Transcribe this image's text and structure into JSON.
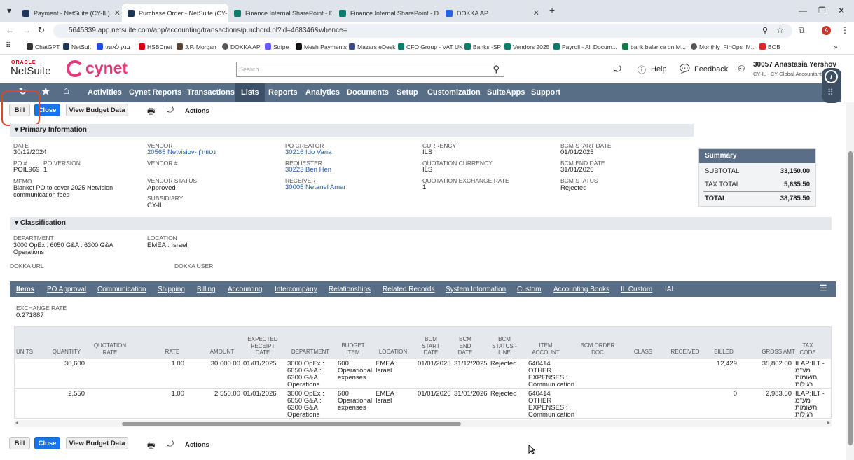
{
  "browser": {
    "tabs": [
      {
        "title": "Payment - NetSuite (CY-IL)",
        "active": false
      },
      {
        "title": "Purchase Order - NetSuite (CY-",
        "active": true
      },
      {
        "title": "Finance Internal SharePoint - D",
        "active": false
      },
      {
        "title": "Finance Internal SharePoint - D",
        "active": false
      },
      {
        "title": "DOKKA AP",
        "active": false
      }
    ],
    "url": "5645339.app.netsuite.com/app/accounting/transactions/purchord.nl?id=468346&whence=",
    "bookmarks": [
      "ChatGPT",
      "NetSuit",
      "בנק לאומי",
      "HSBCnet",
      "J.P. Morgan",
      "DOKKA AP",
      "Stripe",
      "Mesh Payments",
      "Mazars eDesk",
      "CFO Group - VAT UK",
      "Banks -SP",
      "Vendors 2025",
      "Payroll - All Docum...",
      "bank balance on M...",
      "Monthly_FinOps_M...",
      "BOB"
    ]
  },
  "header": {
    "oracle": "ORACLE",
    "netsuite": "NetSuite",
    "brand": "cynet",
    "search_placeholder": "Search",
    "help": "Help",
    "feedback": "Feedback",
    "user_name": "30057 Anastasia Yershov",
    "user_role": "CY-IL - CY-Global Accountant"
  },
  "nav": [
    "Activities",
    "Cynet Reports",
    "Transactions",
    "Lists",
    "Reports",
    "Analytics",
    "Documents",
    "Setup",
    "Customization",
    "SuiteApps",
    "Support"
  ],
  "actions": {
    "bill": "Bill",
    "close": "Close",
    "budget": "View Budget Data",
    "actions": "Actions"
  },
  "primary": {
    "title": "Primary Information",
    "date_l": "DATE",
    "date": "30/12/2024",
    "po_l": "PO #",
    "po": "POIL969",
    "pov_l": "PO VERSION",
    "pov": "1",
    "memo_l": "MEMO",
    "memo1": "Blanket PO to cover 2025 Netvision",
    "memo2": "communication fees",
    "vendor_l": "VENDOR",
    "vendor": "20565 Netvisiov- נטוויז'ן",
    "vnum_l": "VENDOR #",
    "vstatus_l": "VENDOR STATUS",
    "vstatus": "Approved",
    "sub_l": "SUBSIDIARY",
    "sub": "CY-IL",
    "creator_l": "PO CREATOR",
    "creator": "30216 Ido Vana",
    "req_l": "REQUESTER",
    "req": "30223 Ben Hen",
    "recv_l": "RECEIVER",
    "recv": "30005 Netanel Amar",
    "cur_l": "CURRENCY",
    "cur": "ILS",
    "qcur_l": "QUOTATION CURRENCY",
    "qcur": "ILS",
    "qrate_l": "QUOTATION EXCHANGE RATE",
    "qrate": "1",
    "bstart_l": "BCM START DATE",
    "bstart": "01/01/2025",
    "bend_l": "BCM END DATE",
    "bend": "31/01/2026",
    "bstatus_l": "BCM STATUS",
    "bstatus": "Rejected"
  },
  "summary": {
    "title": "Summary",
    "subtotal_l": "SUBTOTAL",
    "subtotal": "33,150.00",
    "tax_l": "TAX TOTAL",
    "tax": "5,635.50",
    "total_l": "TOTAL",
    "total": "38,785.50"
  },
  "classification": {
    "title": "Classification",
    "dept_l": "DEPARTMENT",
    "dept1": "3000 OpEx : 6050 G&A : 6300 G&A",
    "dept2": "Operations",
    "loc_l": "LOCATION",
    "loc": "EMEA : Israel",
    "durl": "DOKKA URL",
    "duser": "DOKKA USER"
  },
  "subtabs": [
    "Items",
    "PO Approval",
    "Communication",
    "Shipping",
    "Billing",
    "Accounting",
    "Intercompany",
    "Relationships",
    "Related Records",
    "System Information",
    "Custom",
    "Accounting Books",
    "IL Custom",
    "IAL"
  ],
  "exch": {
    "label": "EXCHANGE RATE",
    "value": "0.271887"
  },
  "columns": [
    "UNITS",
    "QUANTITY",
    "QUOTATION RATE",
    "RATE",
    "AMOUNT",
    "EXPECTED RECEIPT DATE",
    "DEPARTMENT",
    "BUDGET ITEM",
    "LOCATION",
    "BCM START DATE",
    "BCM END DATE",
    "BCM STATUS - LINE",
    "ITEM ACCOUNT",
    "BCM ORDER DOC",
    "CLASS",
    "RECEIVED",
    "BILLED",
    "GROSS AMT",
    "TAX CODE"
  ],
  "rows": [
    {
      "quantity": "30,600",
      "rate": "1.00",
      "amount": "30,600.00",
      "erd": "01/01/2025",
      "dept": "3000 OpEx :\n6050 G&A :\n6300 G&A\nOperations",
      "budget": "600\nOperational\nexpenses",
      "loc": "EMEA :\nIsrael",
      "start": "01/01/2025",
      "end": "31/12/2025",
      "status": "Rejected",
      "account": "640414\nOTHER\nEXPENSES :\nCommunication",
      "billed": "12,429",
      "gross": "35,802.00",
      "tax": "ILAP:ILT -\nמע\"מ\nתשומות\nרגילות"
    },
    {
      "quantity": "2,550",
      "rate": "1.00",
      "amount": "2,550.00",
      "erd": "01/01/2026",
      "dept": "3000 OpEx :\n6050 G&A :\n6300 G&A\nOperations",
      "budget": "600\nOperational\nexpenses",
      "loc": "EMEA :\nIsrael",
      "start": "01/01/2026",
      "end": "31/01/2026",
      "status": "Rejected",
      "account": "640414\nOTHER\nEXPENSES :\nCommunication",
      "billed": "0",
      "gross": "2,983.50",
      "tax": "ILAP:ILT -\nמע\"מ\nתשומות\nרגילות"
    }
  ]
}
